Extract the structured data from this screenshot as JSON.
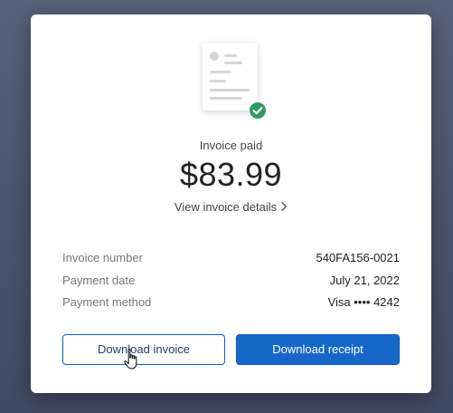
{
  "receipt": {
    "status_label": "Invoice paid",
    "amount": "$83.99",
    "details_link_label": "View invoice details",
    "rows": [
      {
        "key": "Invoice number",
        "value": "540FA156-0021"
      },
      {
        "key": "Payment date",
        "value": "July 21, 2022"
      },
      {
        "key": "Payment method",
        "value": "Visa •••• 4242"
      }
    ]
  },
  "actions": {
    "download_invoice_label": "Download invoice",
    "download_receipt_label": "Download receipt"
  },
  "icons": {
    "status_icon": "document-icon",
    "badge_icon": "check-circle-icon",
    "link_icon": "chevron-right-icon",
    "pointer": "hand-cursor-icon"
  },
  "colors": {
    "accent": "#1767c9",
    "success": "#2e9b5f",
    "backdrop": "#4a5570"
  }
}
